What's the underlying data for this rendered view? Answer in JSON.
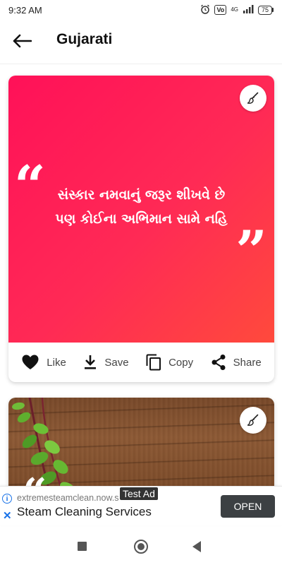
{
  "status_bar": {
    "time": "9:32 AM",
    "vol_label": "Vo\nLTE",
    "network": "4G",
    "battery": "75"
  },
  "app_bar": {
    "title": "Gujarati"
  },
  "cards": [
    {
      "quote_lines": [
        "સંસ્કાર નમવાનું જરૂર શીખવે છે",
        "પણ કોઈના અભિમાન સામે નહિ"
      ],
      "gradient_colors": [
        "#ff1158",
        "#ff4a3c"
      ],
      "actions": [
        {
          "label": "Like",
          "icon": "heart-icon"
        },
        {
          "label": "Save",
          "icon": "download-icon"
        },
        {
          "label": "Copy",
          "icon": "copy-icon"
        },
        {
          "label": "Share",
          "icon": "share-icon"
        }
      ]
    },
    {
      "background": "wood-texture-with-plant"
    }
  ],
  "ad": {
    "tag": "Test Ad",
    "domain": "extremesteamclean.now.s",
    "title": "Steam Cleaning Services",
    "cta": "OPEN"
  },
  "colors": {
    "accent": "#ff1158",
    "ad_button": "#3c4043",
    "ad_icon": "#1a73e8"
  }
}
